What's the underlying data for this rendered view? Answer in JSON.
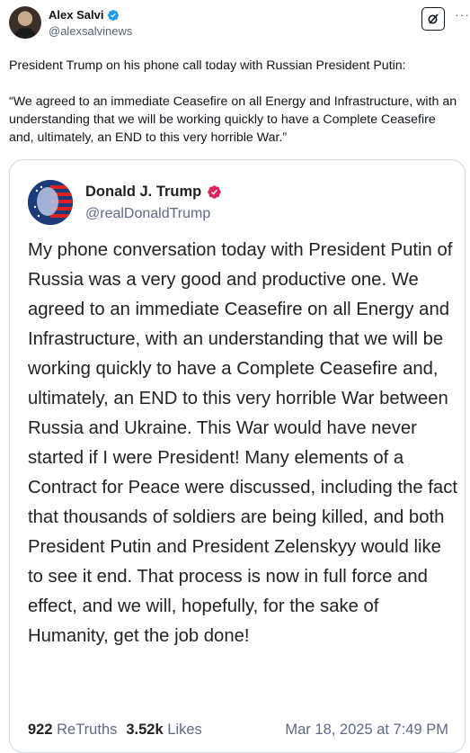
{
  "post": {
    "author_name": "Alex Salvi",
    "author_handle": "@alexsalvinews",
    "text_paragraphs": [
      "President Trump on his phone call today with Russian President Putin:",
      "“We agreed to an immediate Ceasefire on all Energy and Infrastructure, with an understanding that we will be working quickly to have a Complete Ceasefire and, ultimately, an END to this very horrible War.”"
    ],
    "verified_color": "#1d9bf0",
    "more_icon": "···"
  },
  "quote": {
    "author_name": "Donald J. Trump",
    "author_handle": "@realDonaldTrump",
    "verified_color": "#e0245e",
    "text": "My phone conversation today with President Putin of Russia was a very good and productive one. We agreed to an immediate Ceasefire on all Energy and Infrastructure, with an understanding that we will be working quickly to have a Complete Ceasefire and, ultimately, an END to this very horrible War between Russia and Ukraine. This War would have never started if I were President! Many elements of a Contract for Peace were discussed, including the fact that thousands of soldiers are being killed, and both President Putin and President Zelenskyy would like to see it end. That process is now in full force and effect, and we will, hopefully, for the sake of Humanity, get the job done!",
    "retruths_count": "922",
    "retruths_label": "ReTruths",
    "likes_count": "3.52k",
    "likes_label": "Likes",
    "date": "Mar 18, 2025 at 7:49 PM"
  }
}
